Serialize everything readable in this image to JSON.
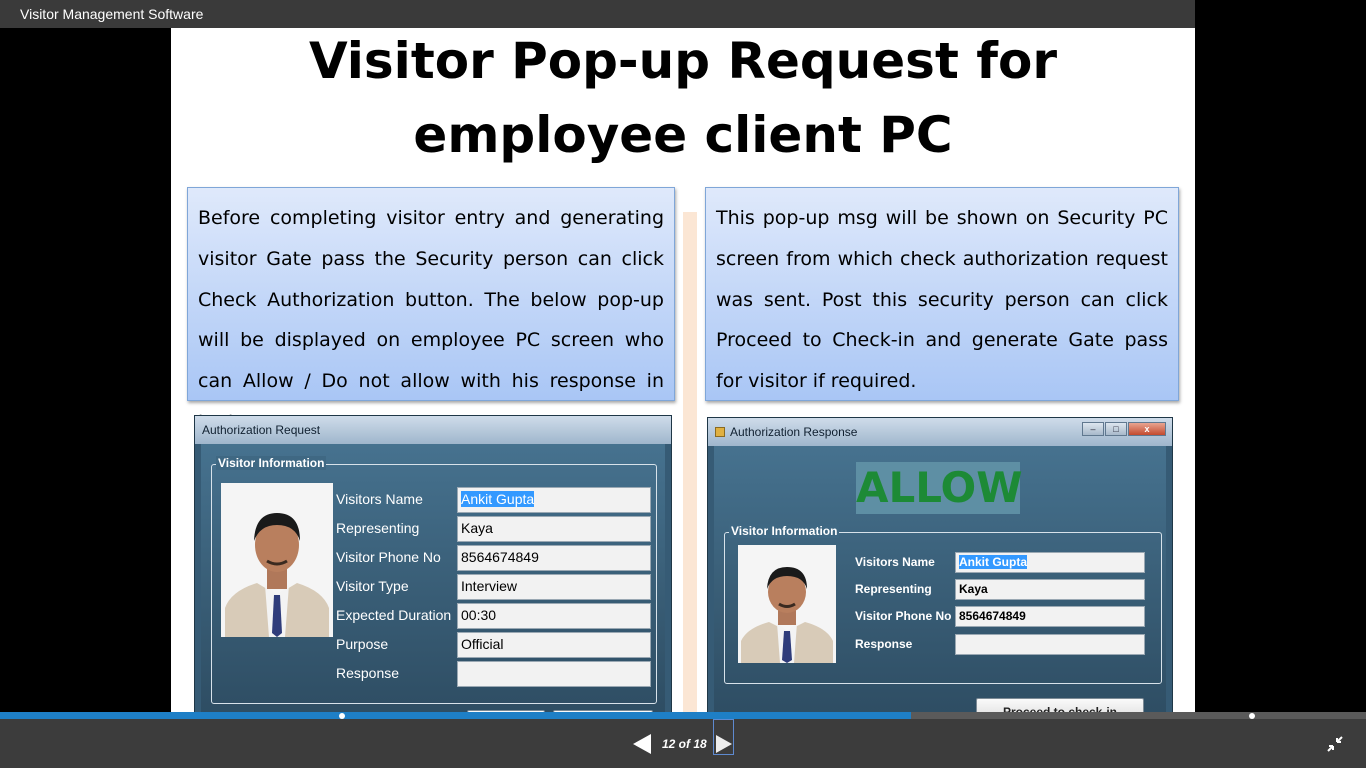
{
  "app": {
    "title": "Visitor Management Software"
  },
  "slide": {
    "title_line1": "Visitor Pop-up Request for",
    "title_line2": "employee client PC",
    "left_text": "Before completing visitor entry and generating visitor Gate pass the Security person can click Check Authorization button. The below pop-up will be displayed on employee PC screen who can Allow / Do not allow with his response in text.",
    "right_text": "This pop-up msg will be shown on Security PC screen from which check authorization request was sent. Post this security person can click Proceed to Check-in and generate Gate pass for visitor if required."
  },
  "request_window": {
    "title": "Authorization Request",
    "group_label": "Visitor Information",
    "fields": [
      {
        "label": "Visitors Name",
        "value": "Ankit Gupta"
      },
      {
        "label": "Representing",
        "value": "Kaya"
      },
      {
        "label": "Visitor Phone No",
        "value": "8564674849"
      },
      {
        "label": "Visitor Type",
        "value": "Interview"
      },
      {
        "label": "Expected Duration",
        "value": "00:30"
      },
      {
        "label": "Purpose",
        "value": "Official"
      },
      {
        "label": "Response",
        "value": ""
      }
    ]
  },
  "response_window": {
    "title": "Authorization Response",
    "status": "ALLOW",
    "group_label": "Visitor Information",
    "fields": [
      {
        "label": "Visitors Name",
        "value": "Ankit Gupta"
      },
      {
        "label": "Representing",
        "value": "Kaya"
      },
      {
        "label": "Visitor Phone No",
        "value": "8564674849"
      },
      {
        "label": "Response",
        "value": ""
      }
    ],
    "proceed_label": "Proceed to check-in"
  },
  "player": {
    "page_counter": "12 of 18",
    "progress": 0.667
  },
  "colors": {
    "progress_fill": "#1e7fc6",
    "allow_text": "#1d8a36",
    "textbox_top": "#dfe9fb",
    "textbox_bottom": "#a9c6f5"
  },
  "icons": {
    "prev": "triangle-left-icon",
    "next": "triangle-right-icon",
    "exit_fullscreen": "compress-arrows-icon"
  }
}
